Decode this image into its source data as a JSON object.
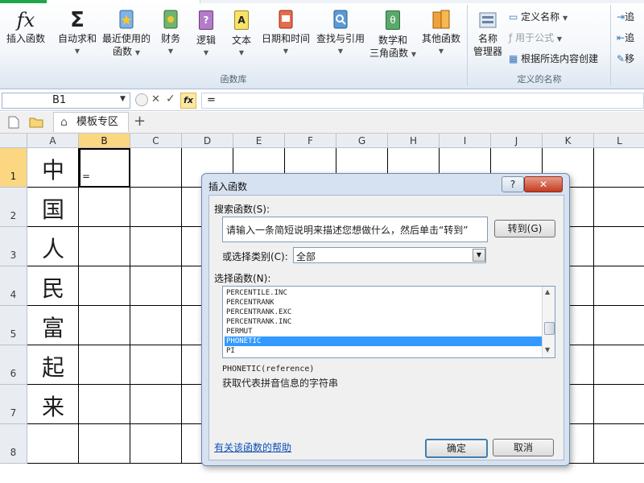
{
  "ribbon": {
    "groups": [
      {
        "label": "函数库"
      },
      {
        "label": "定义的名称"
      }
    ],
    "buttons": {
      "insert_function": "插入函数",
      "autosum": "自动求和",
      "recent_line1": "最近使用的",
      "recent_line2": "函数",
      "financial": "财务",
      "logical": "逻辑",
      "text": "文本",
      "datetime": "日期和时间",
      "lookup": "查找与引用",
      "math_line1": "数学和",
      "math_line2": "三角函数",
      "other": "其他函数",
      "name_mgr_line1": "名称",
      "name_mgr_line2": "管理器",
      "define_name": "定义名称",
      "use_in_formula": "用于公式",
      "create_from_selection": "根据所选内容创建",
      "trace_precedents": "追",
      "trace_dependents": "追",
      "remove_arrows": "移"
    },
    "icon_glyphs": {
      "fx": "fx",
      "sigma": "Σ",
      "math_theta": "θ",
      "text_A": "A",
      "logic_q": "?"
    }
  },
  "formula_bar": {
    "name_box": "B1",
    "cancel_glyph": "✕",
    "enter_glyph": "✓",
    "fx_glyph": "fx",
    "value": "="
  },
  "tabs": {
    "template_tab": "模板专区",
    "add_glyph": "+"
  },
  "grid": {
    "columns": [
      "A",
      "B",
      "C",
      "D",
      "E",
      "F",
      "G",
      "H",
      "I",
      "J",
      "K",
      "L"
    ],
    "rows": [
      "1",
      "2",
      "3",
      "4",
      "5",
      "6",
      "7",
      "8"
    ],
    "active_col": "B",
    "active_row": "1",
    "column_a_values": [
      "中",
      "国",
      "人",
      "民",
      "富",
      "起",
      "来",
      ""
    ],
    "b1_value": "="
  },
  "dialog": {
    "title": "插入函数",
    "help_glyph": "?",
    "close_glyph": "✕",
    "search_label": "搜索函数(S):",
    "search_text": "请输入一条简短说明来描述您想做什么，然后单击“转到”",
    "goto_button": "转到(G)",
    "category_label": "或选择类别(C):",
    "category_value": "全部",
    "function_list_label": "选择函数(N):",
    "functions": [
      "PERCENTILE.INC",
      "PERCENTRANK",
      "PERCENTRANK.EXC",
      "PERCENTRANK.INC",
      "PERMUT",
      "PHONETIC",
      "PI"
    ],
    "selected_function": "PHONETIC",
    "signature": "PHONETIC(reference)",
    "description": "获取代表拼音信息的字符串",
    "help_link": "有关该函数的帮助",
    "ok_button": "确定",
    "cancel_button": "取消"
  },
  "colors": {
    "ribbon_bg": "#f3f6fa",
    "active_header": "#fcd782",
    "dialog_frame": "#d6e2f1",
    "selection": "#3399ff",
    "close_button": "#c23b22",
    "link": "#0b4fb5"
  }
}
